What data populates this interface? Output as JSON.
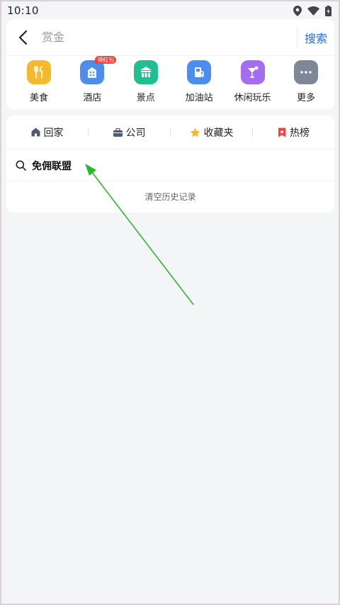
{
  "status_bar": {
    "time": "10:10"
  },
  "search": {
    "placeholder": "赏金",
    "button_label": "搜索"
  },
  "categories": [
    {
      "label": "美食",
      "color": "#f6b82c",
      "icon": "fork-knife-icon"
    },
    {
      "label": "酒店",
      "color": "#4d8df0",
      "icon": "hotel-icon",
      "badge": "领红包"
    },
    {
      "label": "景点",
      "color": "#1fbf91",
      "icon": "landmark-icon"
    },
    {
      "label": "加油站",
      "color": "#4d8df0",
      "icon": "fuel-icon"
    },
    {
      "label": "休闲玩乐",
      "color": "#a46cf0",
      "icon": "cocktail-icon"
    },
    {
      "label": "更多",
      "color": "#7d8797",
      "icon": "more-icon"
    }
  ],
  "quick_links": [
    {
      "label": "回家",
      "icon": "home-icon"
    },
    {
      "label": "公司",
      "icon": "briefcase-icon"
    },
    {
      "label": "收藏夹",
      "icon": "star-icon"
    },
    {
      "label": "热榜",
      "icon": "bookmark-icon"
    }
  ],
  "history": [
    {
      "text": "免佣联盟"
    }
  ],
  "clear_history_label": "清空历史记录",
  "colors": {
    "accent": "#2a6bd9",
    "annotation_arrow": "#2db82d"
  }
}
